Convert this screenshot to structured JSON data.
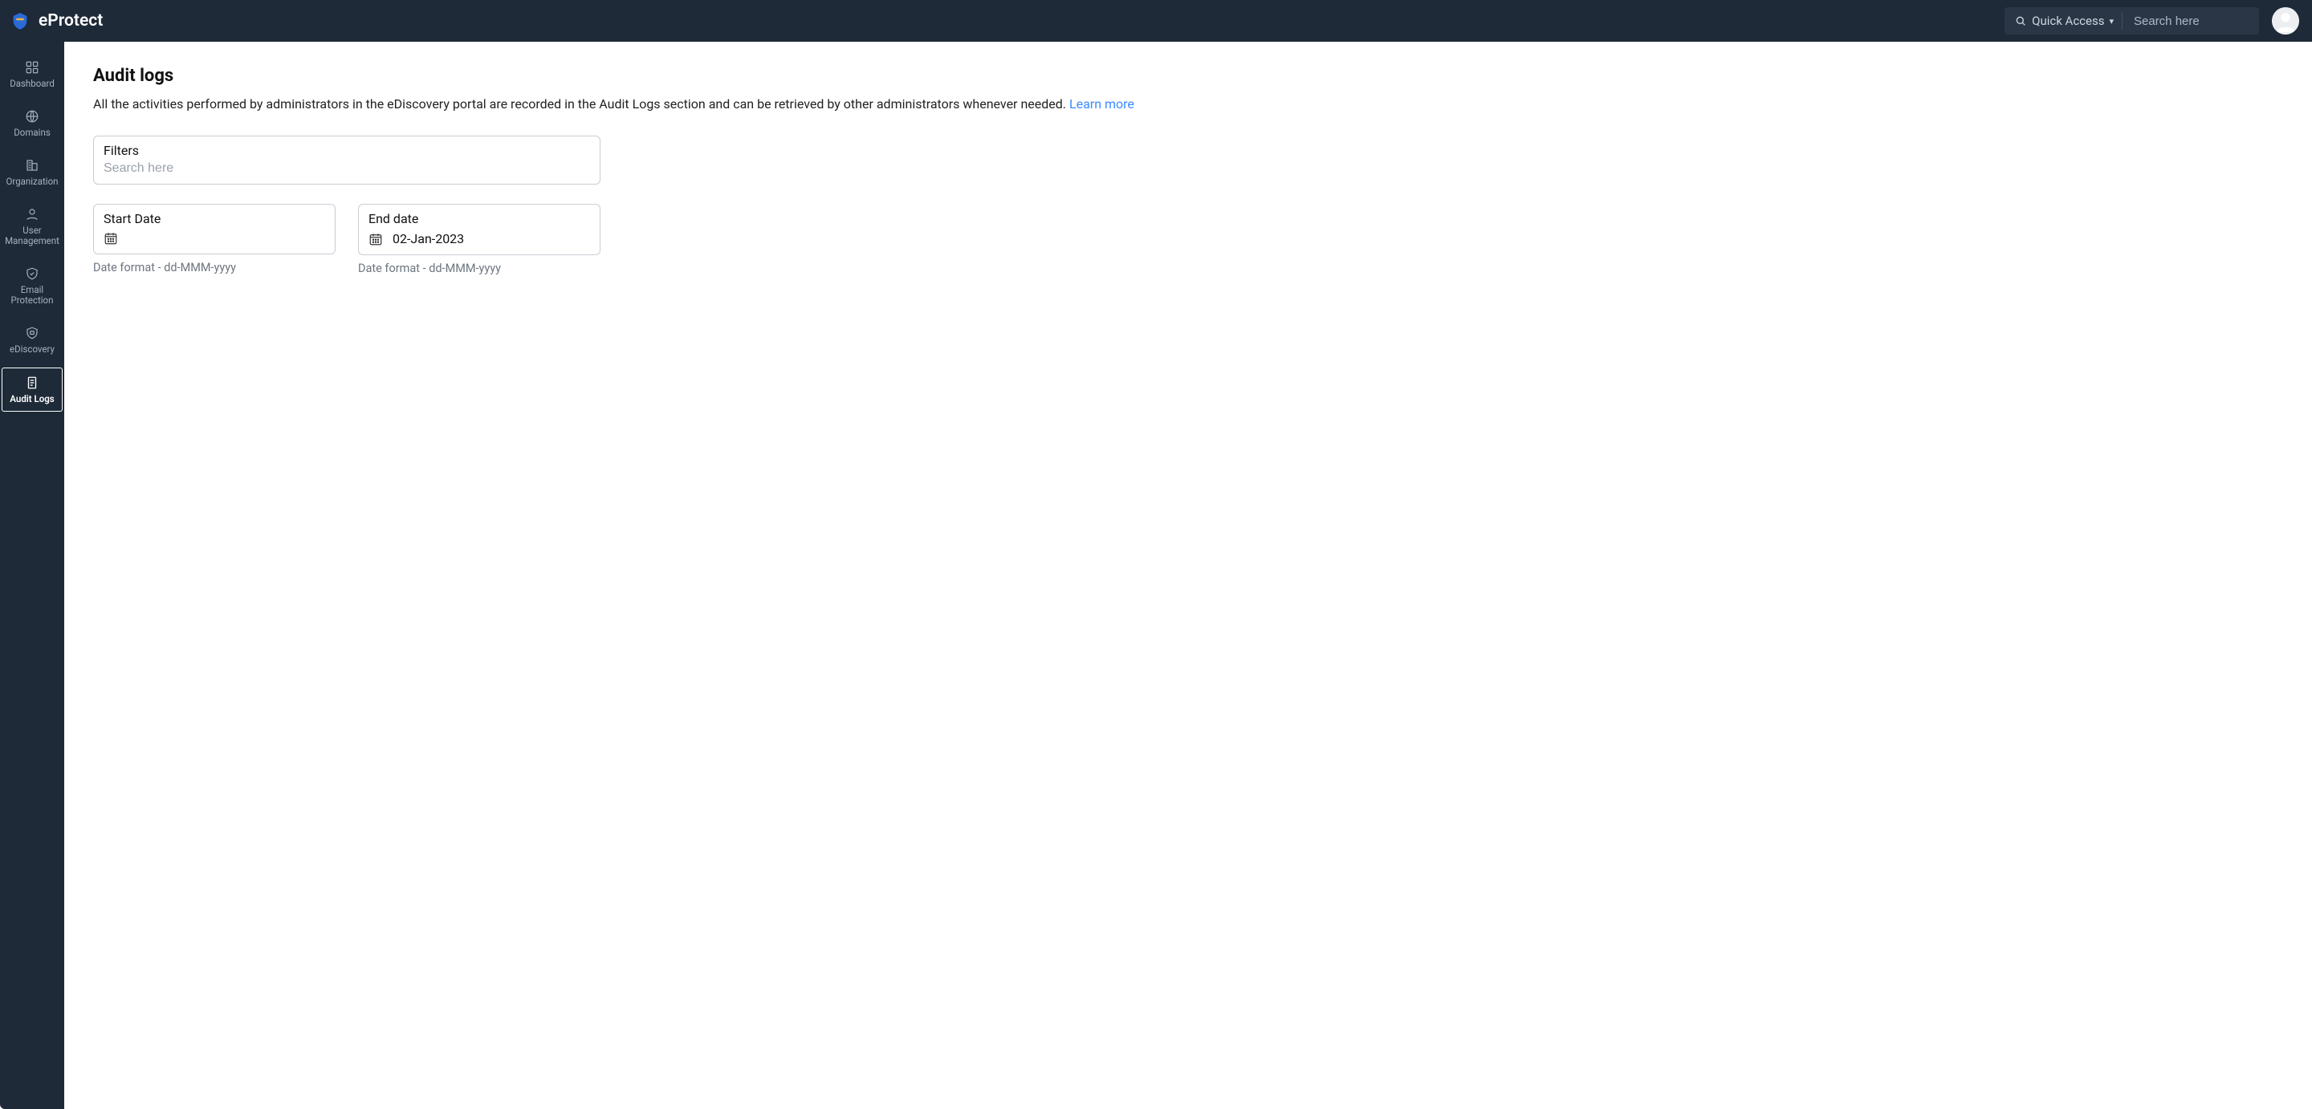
{
  "brand": {
    "name": "eProtect"
  },
  "header": {
    "quick_access": "Quick Access",
    "search_placeholder": "Search here"
  },
  "sidebar": {
    "items": [
      {
        "id": "dashboard",
        "label": "Dashboard",
        "icon": "dashboard-icon",
        "active": false
      },
      {
        "id": "domains",
        "label": "Domains",
        "icon": "globe-icon",
        "active": false
      },
      {
        "id": "organization",
        "label": "Organization",
        "icon": "building-icon",
        "active": false
      },
      {
        "id": "user-management",
        "label": "User\nManagement",
        "icon": "user-icon",
        "active": false
      },
      {
        "id": "email-protection",
        "label": "Email\nProtection",
        "icon": "shield-icon",
        "active": false
      },
      {
        "id": "ediscovery",
        "label": "eDiscovery",
        "icon": "archive-icon",
        "active": false
      },
      {
        "id": "audit-logs",
        "label": "Audit Logs",
        "icon": "log-icon",
        "active": true
      }
    ]
  },
  "page": {
    "title": "Audit logs",
    "description": "All the activities performed by administrators in the eDiscovery portal are recorded in the Audit Logs section and can be retrieved by other administrators whenever needed.",
    "learn_more": "Learn more"
  },
  "filters": {
    "label": "Filters",
    "placeholder": "Search here",
    "value": ""
  },
  "dates": {
    "start": {
      "label": "Start Date",
      "value": "",
      "hint": "Date format - dd-MMM-yyyy"
    },
    "end": {
      "label": "End date",
      "value": "02-Jan-2023",
      "hint": "Date format - dd-MMM-yyyy"
    }
  }
}
